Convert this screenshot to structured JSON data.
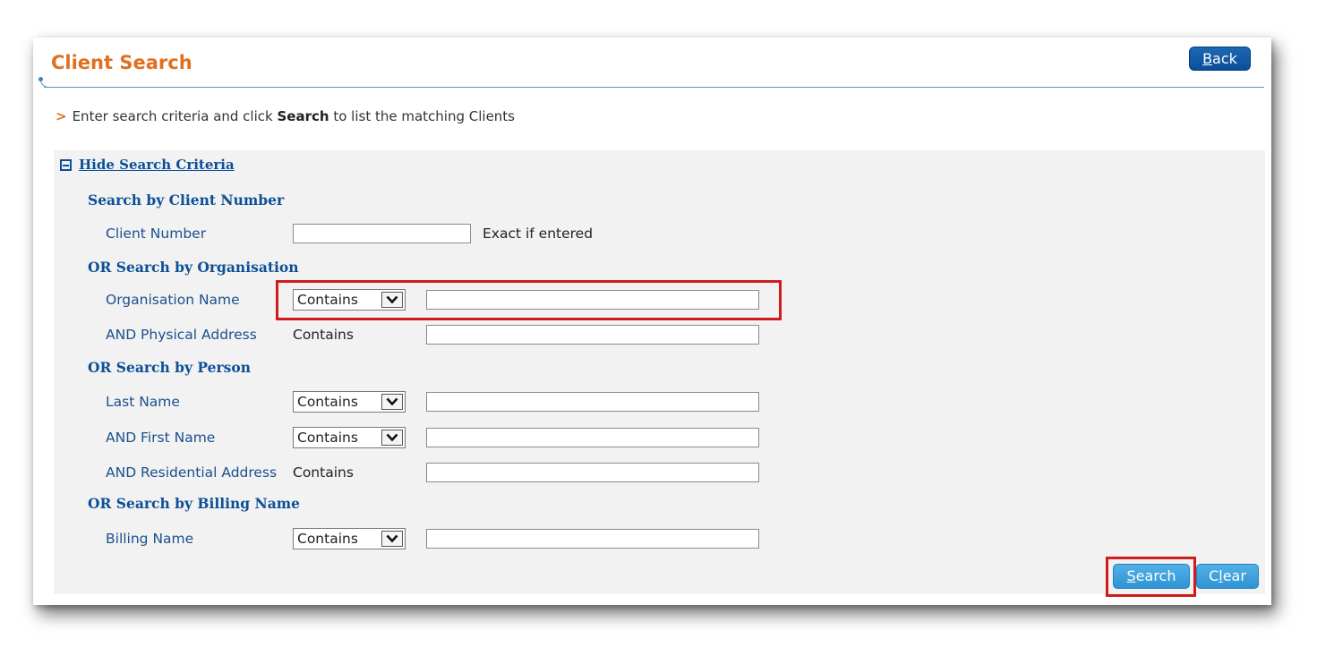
{
  "header": {
    "title": "Client Search",
    "back_button": {
      "mnemonic": "B",
      "rest": "ack"
    }
  },
  "instruction": {
    "marker": ">",
    "before": "Enter search criteria and click",
    "emphasis": "Search",
    "after": "to list the matching Clients"
  },
  "panel": {
    "toggle_label": "Hide Search Criteria",
    "sections": {
      "client_number": {
        "heading": "Search by Client Number",
        "client_number": {
          "label": "Client Number",
          "value": "",
          "hint": "Exact if entered"
        }
      },
      "organisation": {
        "heading": "OR Search by Organisation",
        "organisation_name": {
          "label": "Organisation Name",
          "operator": "Contains",
          "value": ""
        },
        "physical_address": {
          "label": "AND Physical Address",
          "operator": "Contains",
          "value": ""
        }
      },
      "person": {
        "heading": "OR Search by Person",
        "last_name": {
          "label": "Last Name",
          "operator": "Contains",
          "value": ""
        },
        "first_name": {
          "label": "AND First Name",
          "operator": "Contains",
          "value": ""
        },
        "residential_address": {
          "label": "AND Residential Address",
          "operator": "Contains",
          "value": ""
        }
      },
      "billing": {
        "heading": "OR Search by Billing Name",
        "billing_name": {
          "label": "Billing Name",
          "operator": "Contains",
          "value": ""
        }
      }
    },
    "buttons": {
      "search": {
        "mnemonic": "S",
        "rest": "earch"
      },
      "clear": {
        "before": "C",
        "mnemonic": "l",
        "rest": "ear"
      }
    }
  },
  "colors": {
    "title": "#e07020",
    "label_blue": "#1b4f8f",
    "heading_blue": "#0d4f96",
    "highlight_red": "#d11a1a",
    "button_light_blue": "#2f93d3",
    "button_dark_blue": "#0b4f98"
  }
}
